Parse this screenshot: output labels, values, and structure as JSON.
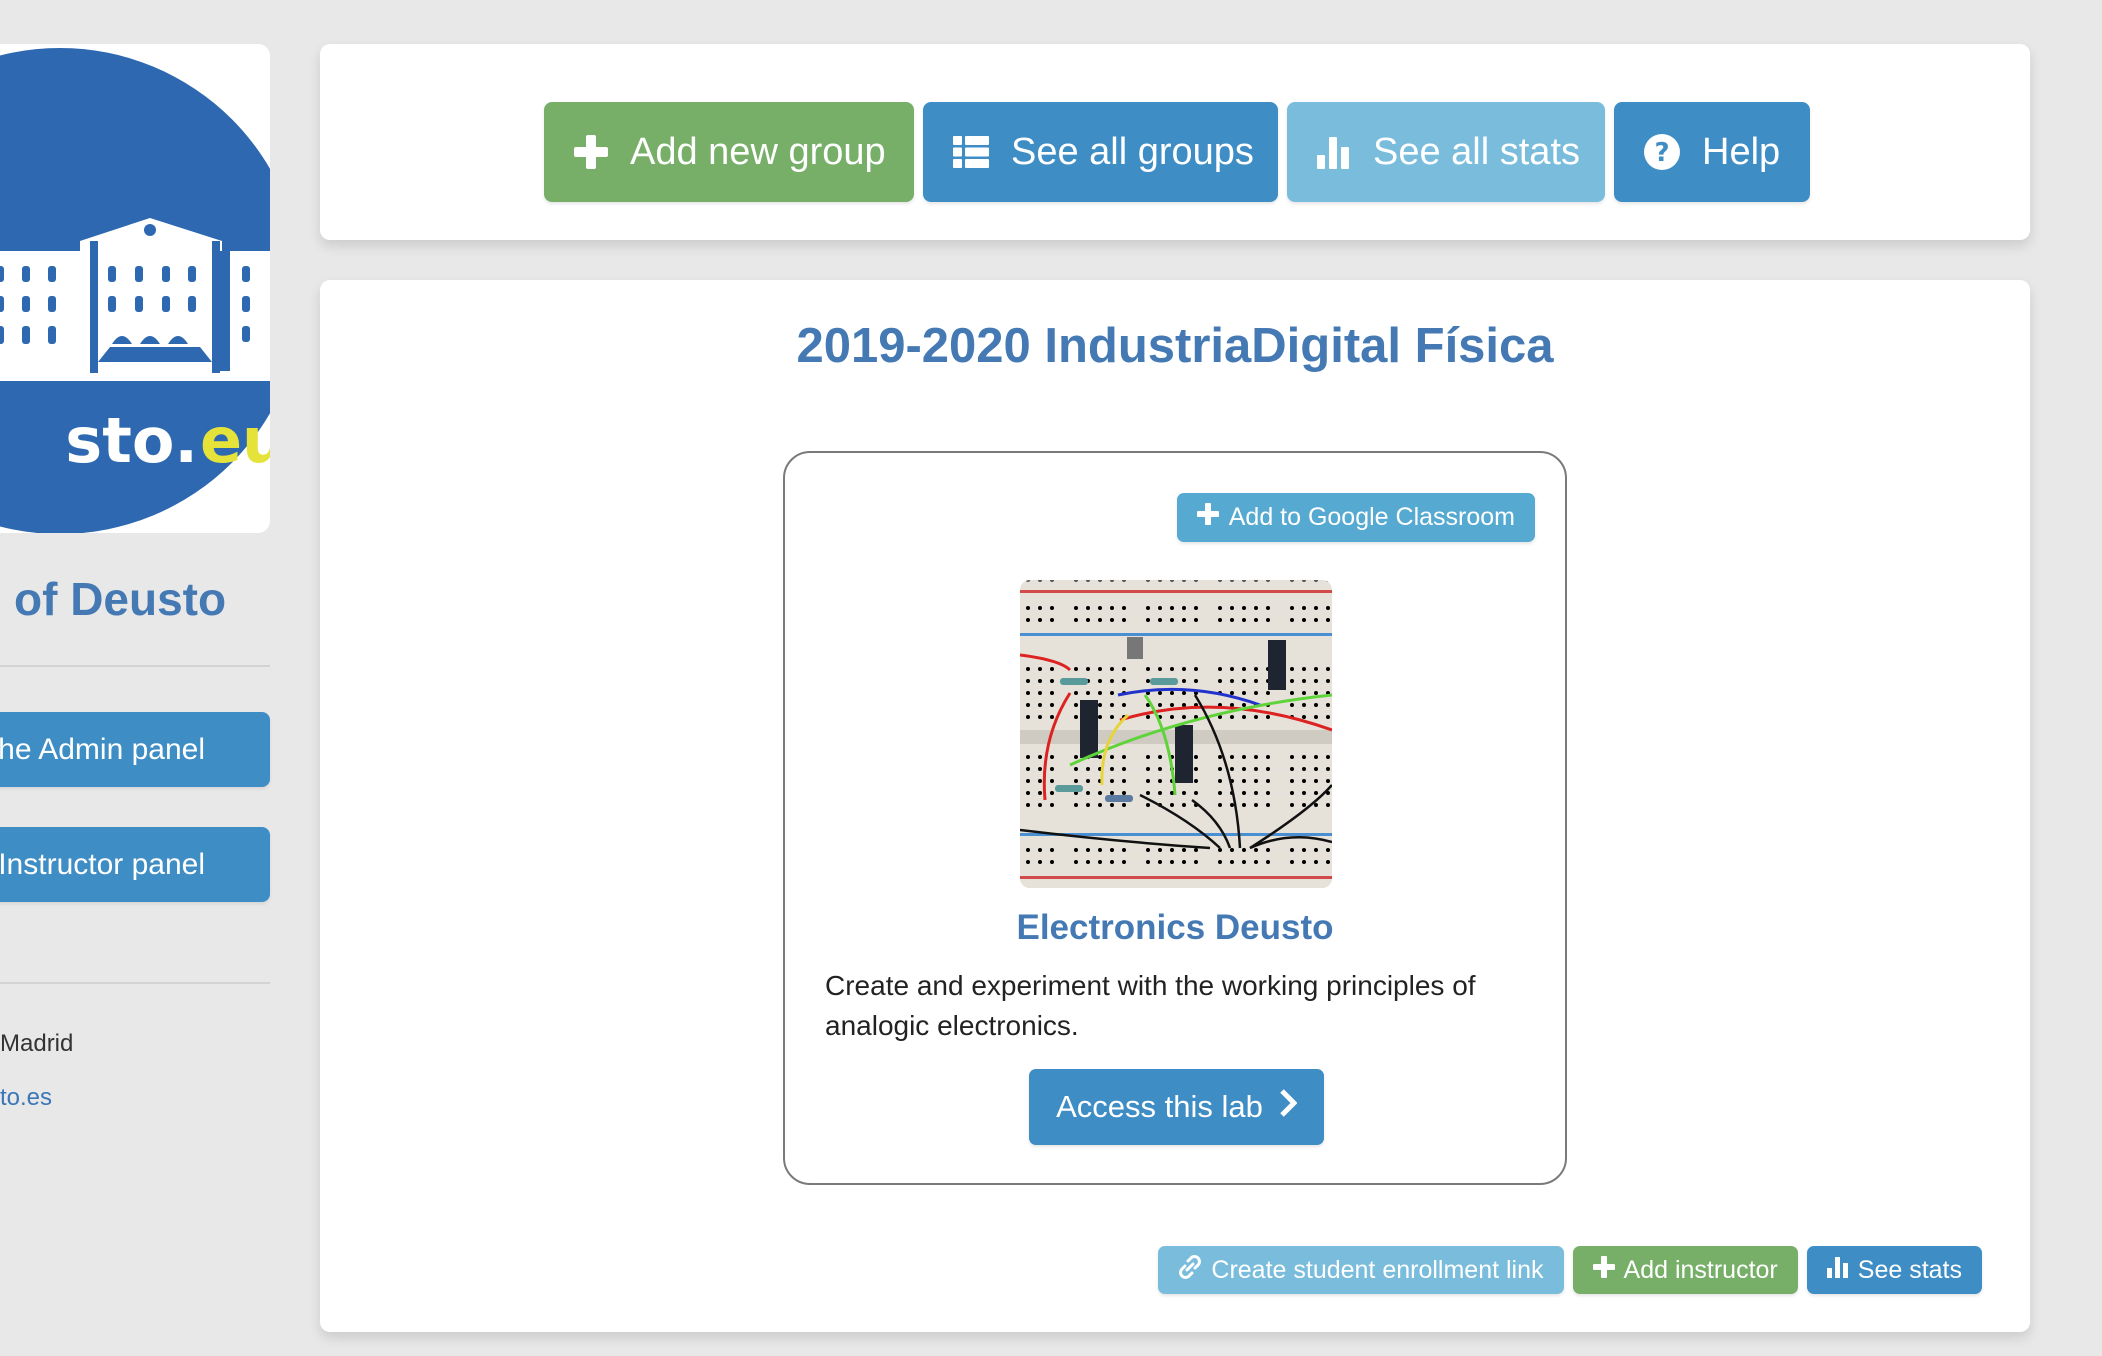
{
  "sidebar": {
    "logo": {
      "text_white": "sto.",
      "text_yellow": "eus",
      "colors": {
        "circle": "#2d68b0",
        "yellow": "#e5e23a"
      }
    },
    "org_name": "of Deusto",
    "admin_button_label": "he Admin panel",
    "instructor_button_label": "e Instructor panel",
    "location": "Madrid",
    "link": "to.es"
  },
  "toolbar": {
    "add_group_label": "Add new group",
    "see_groups_label": "See all groups",
    "see_stats_label": "See all stats",
    "help_label": "Help"
  },
  "group": {
    "title": "2019-2020 IndustriaDigital Física",
    "lab": {
      "google_classroom_label": "Add to Google Classroom",
      "name": "Electronics Deusto",
      "description": "Create and experiment with the working principles of analogic electronics.",
      "access_label": "Access this lab"
    },
    "actions": {
      "enrollment_link_label": "Create student enrollment link",
      "add_instructor_label": "Add instructor",
      "see_stats_label": "See stats"
    }
  },
  "colors": {
    "primary": "#3f8dc5",
    "success": "#77af68",
    "info": "#79bcdb",
    "heading": "#4479b4",
    "background": "#e8e8e8"
  }
}
